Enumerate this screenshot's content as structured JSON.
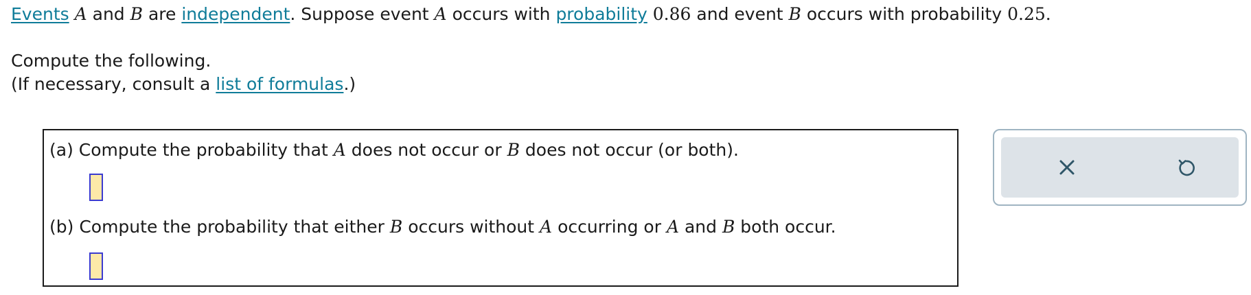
{
  "intro": {
    "events_link": "Events",
    "var_a": "A",
    "and": "and",
    "var_b": "B",
    "are": "are",
    "independent_link": "independent",
    "suppose": ". Suppose event",
    "var_a2": "A",
    "occurs_with": "occurs with",
    "probability_link": "probability",
    "p_a": "0.86",
    "and_event": "and event",
    "var_b2": "B",
    "occurs_with_probability": "occurs with probability",
    "p_b": "0.25",
    "period": "."
  },
  "compute_text": "Compute the following.",
  "consult": {
    "prefix": "(If necessary, consult a",
    "link": "list of formulas",
    "suffix": ".)"
  },
  "part_a": {
    "prefix": "(a) Compute the probability that",
    "var1": "A",
    "mid": "does not occur or",
    "var2": "B",
    "suffix": "does not occur (or both).",
    "value": ""
  },
  "part_b": {
    "prefix": "(b) Compute the probability that either",
    "var1": "B",
    "mid1": "occurs without",
    "var2": "A",
    "mid2": "occurring or",
    "var3": "A",
    "mid3": "and",
    "var4": "B",
    "suffix": "both occur.",
    "value": ""
  },
  "tools": {
    "clear_icon": "close-icon",
    "undo_icon": "undo-icon",
    "icon_color": "#2f5668"
  },
  "colors": {
    "link": "#0f7c99",
    "input_fill": "#fde9a8",
    "input_border": "#3b3bd0",
    "panel_bg": "#dde3e8",
    "panel_border": "#9fb4c2"
  }
}
